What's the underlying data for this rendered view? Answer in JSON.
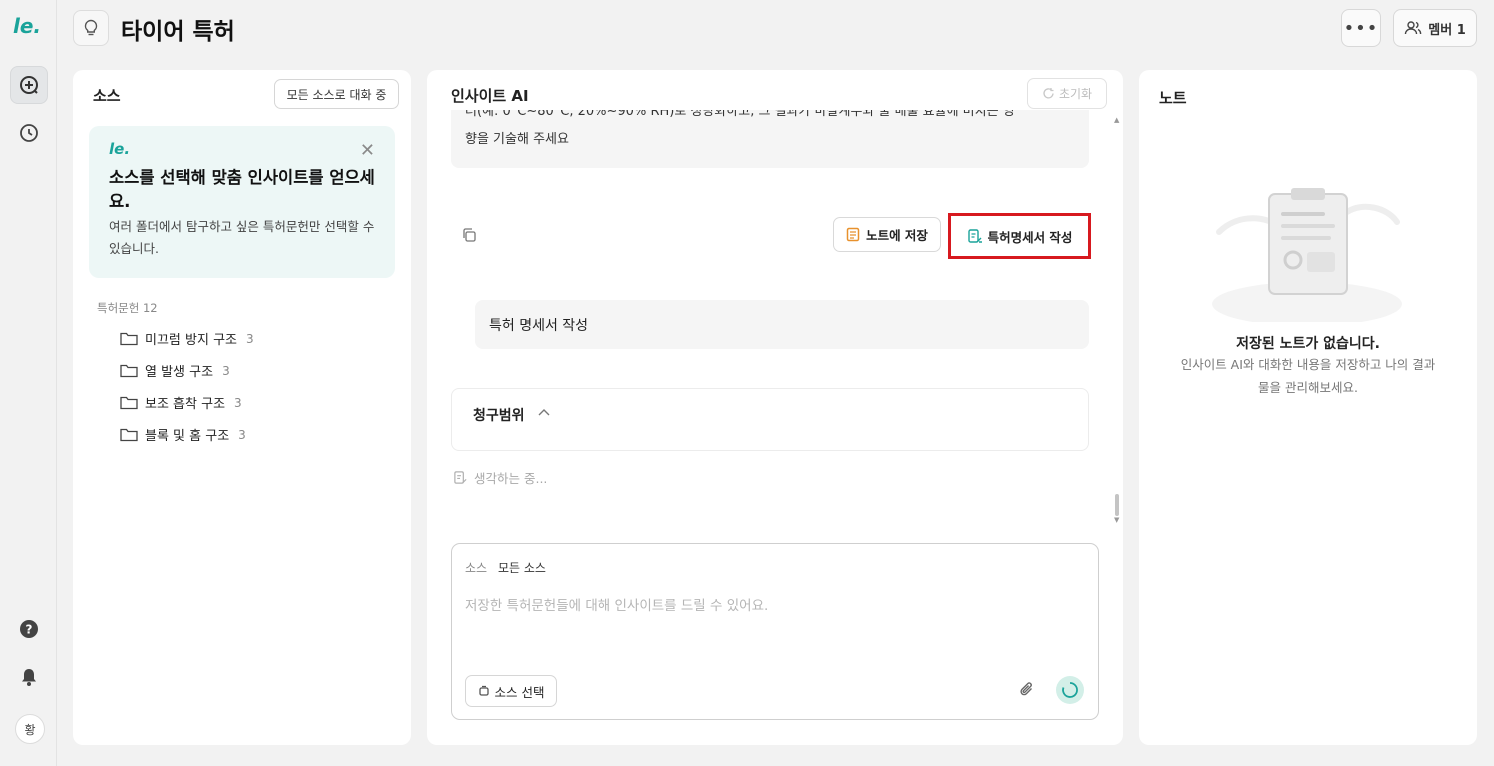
{
  "app": {
    "logo_text": "le.",
    "avatar_initial": "황"
  },
  "header": {
    "title": "타이어 특허",
    "more_label": "•••",
    "member_label": "멤버 1"
  },
  "sources_panel": {
    "heading": "소스",
    "chat_all_label": "모든 소스로 대화 중",
    "tip": {
      "title": "소스를 선택해 맞춤 인사이트를 얻으세요.",
      "description": "여러 폴더에서 탐구하고 싶은 특허문헌만 선택할 수 있습니다."
    },
    "tree_label": "특허문헌 12",
    "folders": [
      {
        "name": "미끄럼 방지 구조",
        "count": "3"
      },
      {
        "name": "열 발생 구조",
        "count": "3"
      },
      {
        "name": "보조 흡착 구조",
        "count": "3"
      },
      {
        "name": "블록 및 홈 구조",
        "count": "3"
      }
    ]
  },
  "insight_panel": {
    "heading": "인사이트 AI",
    "reset_label": "초기화",
    "prompt_text_line1": "터(예: 0°C~80°C, 20%~90% RH)로 정량화하고, 그 결과가 마찰계수와 물 배출 효율에 미치는 영",
    "prompt_text_line2": "향을 기술해 주세요",
    "save_note_label": "노트에 저장",
    "write_patent_label": "특허명세서 작성",
    "user_message": "특허 명세서 작성",
    "claims_label": "청구범위",
    "thinking_label": "생각하는 중...",
    "composer": {
      "source_label": "소스",
      "source_value": "모든 소스",
      "placeholder": "저장한 특허문헌들에 대해 인사이트를 드릴 수 있어요.",
      "select_source_label": "소스 선택"
    }
  },
  "notes_panel": {
    "heading": "노트",
    "empty_title": "저장된 노트가 없습니다.",
    "empty_description": "인사이트 AI와 대화한 내용을 저장하고 나의 결과물을 관리해보세요."
  },
  "colors": {
    "brand": "#1aa39a",
    "highlight_border": "#d7191f",
    "note_icon": "#e8912d"
  }
}
